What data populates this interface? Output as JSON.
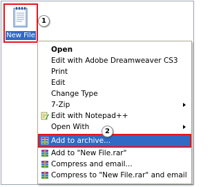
{
  "desktop": {
    "file": {
      "label": "New File",
      "icon": "notepad-file-icon"
    }
  },
  "callouts": {
    "one": "1",
    "two": "2"
  },
  "context_menu": {
    "items": [
      {
        "label": "Open",
        "bold": true
      },
      {
        "label": "Edit with Adobe Dreamweaver CS3"
      },
      {
        "label": "Print"
      },
      {
        "label": "Edit"
      },
      {
        "label": "Change Type"
      },
      {
        "label": "7-Zip",
        "submenu": true
      },
      {
        "label": "Edit with Notepad++",
        "icon": "notepad-plus-plus-icon"
      },
      {
        "label": "Open With",
        "submenu": true
      },
      {
        "label": "Add to archive...",
        "icon": "winrar-icon",
        "highlighted": true
      },
      {
        "label": "Add to \"New File.rar\"",
        "icon": "winrar-icon"
      },
      {
        "label": "Compress and email...",
        "icon": "winrar-icon"
      },
      {
        "label": "Compress to \"New File.rar\" and email",
        "icon": "winrar-icon"
      }
    ]
  },
  "colors": {
    "highlight": "#316ac5",
    "annotation": "#e8121b"
  }
}
